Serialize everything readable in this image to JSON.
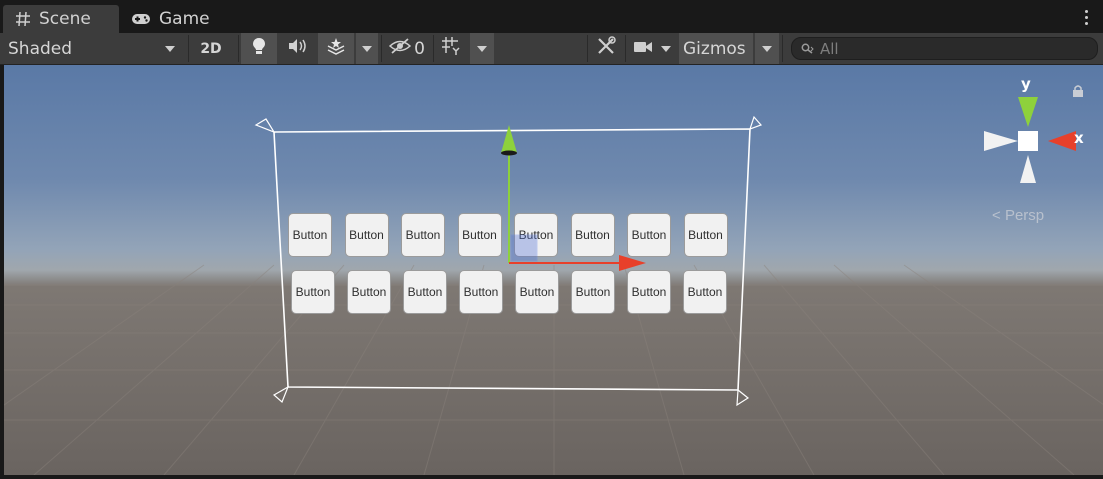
{
  "tabs": [
    {
      "label": "Scene",
      "icon": "hash-icon",
      "active": true
    },
    {
      "label": "Game",
      "icon": "gamepad-icon",
      "active": false
    }
  ],
  "toolbar": {
    "draw_mode": "Shaded",
    "mode_2d": "2D",
    "hidden_count": "0",
    "gizmos": "Gizmos",
    "search_placeholder": "All"
  },
  "scene": {
    "row1_buttons": [
      "Button",
      "Button",
      "Button",
      "Button",
      "Button",
      "Button",
      "Button",
      "Button"
    ],
    "row2_buttons": [
      "Button",
      "Button",
      "Button",
      "Button",
      "Button",
      "Button",
      "Button",
      "Button"
    ]
  },
  "orientation_gizmo": {
    "y_label": "y",
    "x_label": "x",
    "projection": "Persp"
  },
  "colors": {
    "y_axis": "#8ed13c",
    "x_axis": "#e8402a",
    "sky_top": "#5a79a6",
    "ground": "#6a6460"
  }
}
